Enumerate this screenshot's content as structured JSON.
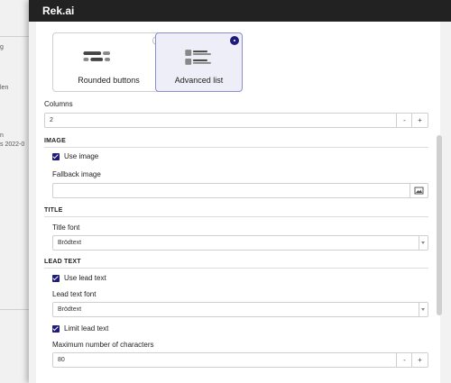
{
  "background": {
    "fragments": [
      "g",
      "len",
      "n",
      "s 2022-0"
    ]
  },
  "modal": {
    "title": "Rek.ai"
  },
  "layout_options": [
    {
      "label": "Rounded buttons",
      "selected": false,
      "icon": "rounded-buttons-icon"
    },
    {
      "label": "Advanced list",
      "selected": true,
      "icon": "advanced-list-icon"
    }
  ],
  "columns": {
    "label": "Columns",
    "value": "2",
    "decrement": "-",
    "increment": "+"
  },
  "image_section": {
    "title": "IMAGE",
    "use_image_label": "Use image",
    "use_image_checked": true,
    "fallback_label": "Fallback image",
    "fallback_value": "",
    "picker_icon": "image-icon"
  },
  "title_section": {
    "title": "TITLE",
    "font_label": "Title font",
    "font_value": "Brödtext"
  },
  "lead_section": {
    "title": "LEAD TEXT",
    "use_lead_label": "Use lead text",
    "use_lead_checked": true,
    "font_label": "Lead text font",
    "font_value": "Brödtext",
    "limit_label": "Limit lead text",
    "limit_checked": true,
    "max_chars_label": "Maximum number of characters",
    "max_chars_value": "80",
    "decrement": "-",
    "increment": "+"
  }
}
